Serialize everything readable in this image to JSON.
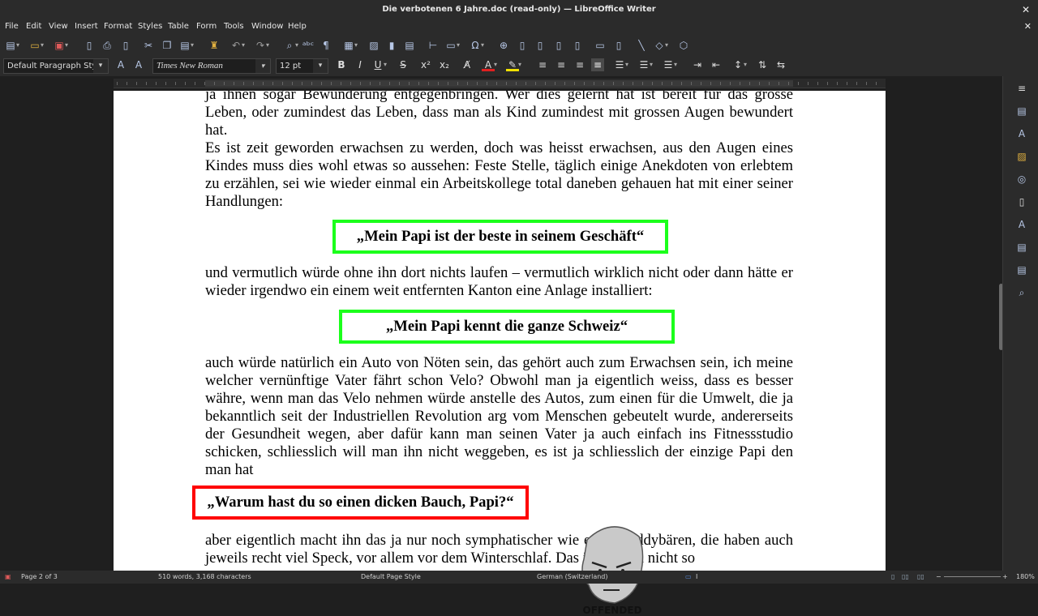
{
  "window": {
    "title": "Die verbotenen 6 Jahre.doc (read-only) — LibreOffice Writer"
  },
  "menu": [
    "File",
    "Edit",
    "View",
    "Insert",
    "Format",
    "Styles",
    "Table",
    "Form",
    "Tools",
    "Window",
    "Help"
  ],
  "formatting": {
    "paragraph_style": "Default Paragraph Style",
    "font_name": "Times New Roman",
    "font_size": "12 pt"
  },
  "document": {
    "p1": "ja ihnen sogar Bewunderung entgegenbringen. Wer dies gelernt hat ist bereit für das grosse Leben, oder zumindest das Leben, dass man als Kind zumindest mit grossen Augen bewundert hat.",
    "p2": "Es ist zeit geworden erwachsen zu werden, doch was heisst erwachsen, aus den Augen eines Kindes muss dies wohl etwas so aussehen: Feste Stelle, täglich einige Anekdoten von erlebtem zu erzählen, sei wie wieder einmal ein Arbeitskollege total daneben gehauen hat mit einer seiner Handlungen:",
    "quote1": "„Mein Papi ist der beste in seinem Geschäft“",
    "p3": "und vermutlich würde ohne ihn dort nichts laufen – vermutlich wirklich nicht oder dann hätte er wieder irgendwo ein einem weit entfernten Kanton eine Anlage installiert:",
    "quote2": "„Mein Papi kennt die ganze Schweiz“",
    "p4": "auch würde natürlich ein Auto von Nöten sein, das gehört auch zum Erwachsen sein, ich meine welcher vernünftige Vater fährt schon Velo? Obwohl man ja eigentlich weiss, dass es besser währe, wenn man das Velo nehmen würde anstelle des Autos, zum einen für die Umwelt, die ja bekanntlich seit der Industriellen Revolution arg vom Menschen gebeutelt wurde, andererseits der Gesundheit wegen, aber dafür kann man seinen Vater ja auch einfach ins Fitnessstudio schicken, schliesslich will man ihn nicht weggeben, es ist ja schliesslich der einzige Papi den man hat",
    "quote3": "„Warum hast du so einen dicken Bauch, Papi?“",
    "p5": "aber eigentlich macht ihn das ja nur noch symphatischer wie einen Teddybären, die haben auch jeweils recht viel Speck, vor allem vor dem Winterschlaf. Das ist ja auch nicht so",
    "meme_caption": "OFFENDED"
  },
  "status": {
    "page": "Page 2 of 3",
    "words": "510 words, 3,168 characters",
    "page_style": "Default Page Style",
    "language": "German (Switzerland)",
    "zoom": "180%"
  },
  "colors": {
    "quote_border_green": "#1bff1b",
    "quote_border_red": "#ff0000",
    "ui_background": "#2b2b2b"
  }
}
